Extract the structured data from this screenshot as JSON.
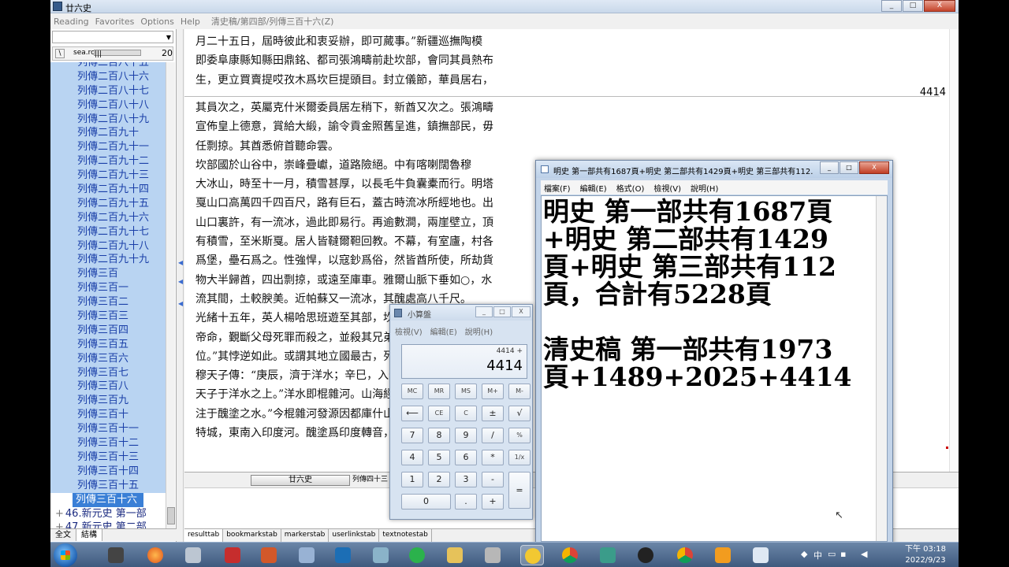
{
  "window": {
    "title": "廿六史",
    "controls": [
      "_",
      "□",
      "X"
    ]
  },
  "menubar": {
    "items": [
      "Reading",
      "Favorites",
      "Options",
      "Help"
    ],
    "path": "清史稿/第四部/列傳三百十六(Z)"
  },
  "left_pane": {
    "combo_value": "",
    "toolbar": {
      "icon": "\\",
      "label": "sea.rc",
      "slider": "|||",
      "number": "20"
    },
    "tree_items": [
      "列傳二百八十五",
      "列傳二百八十六",
      "列傳二百八十七",
      "列傳二百八十八",
      "列傳二百八十九",
      "列傳二百九十",
      "列傳二百九十一",
      "列傳二百九十二",
      "列傳二百九十三",
      "列傳二百九十四",
      "列傳二百九十五",
      "列傳二百九十六",
      "列傳二百九十七",
      "列傳二百九十八",
      "列傳二百九十九",
      "列傳三百",
      "列傳三百一",
      "列傳三百二",
      "列傳三百三",
      "列傳三百四",
      "列傳三百五",
      "列傳三百六",
      "列傳三百七",
      "列傳三百八",
      "列傳三百九",
      "列傳三百十",
      "列傳三百十一",
      "列傳三百十二",
      "列傳三百十三",
      "列傳三百十四",
      "列傳三百十五"
    ],
    "selected_item": "列傳三百十六",
    "books": [
      {
        "num": "46.",
        "label": "新元史 第一部"
      },
      {
        "num": "47.",
        "label": "新元史 第二部"
      }
    ],
    "tabs": [
      "全文",
      "結構"
    ]
  },
  "text_pane": {
    "page_number": "4414",
    "lines_top": [
      "月二十五日，屆時彼此和衷妥辦，即可蕆事。”新疆巡撫陶模",
      "即委阜康縣知縣田鼎銘、都司張鴻疇前赴坎部，會同其員熱布",
      "生，更立買賣提哎孜木爲坎巨提頭目。封立儀節，華員居右，"
    ],
    "lines_bottom": [
      "其員次之，英屬克什米爾委員居左稍下，新酋又次之。張鴻疇",
      "宣佈皇上德意，賞給大緞，諭令貢金照舊呈進，鎮撫部民，毋",
      "任剽掠。其酋悉俯首聽命雲。",
      "坎部國於山谷中，崇峰疊巘，道路險絕。中有喀喇闊魯穆",
      "大冰山，時至十一月，積雪甚厚，以長毛牛負囊橐而行。明塔",
      "戛山口高萬四千四百尺，路有巨石，蓋古時流冰所經地也。出",
      "山口裏許，有一流冰，過此即易行。再逾數澗，兩崖壁立，頂",
      "有積雪，至米斯戛。居人皆韃爾靼回教。不幕，有室廬，村各",
      "爲堡，壘石爲之。性強悍，以寇鈔爲俗，然皆酋所使，所劫貨",
      "物大半歸酋，四出剽掠，或遠至庫車。雅爾山脈下垂如○，水",
      "流其間，土較腴美。近帕蘇又一流冰，其醜處高八千尺。",
      "光緒十五年，英人楊哈思班遊至其部，坎",
      "帝命，覲斷父母死罪而殺之，並殺其兄弟",
      "位。”其悖逆如此。或謂其地立國最古，列",
      "穆天子傳：“庚辰，濟于洋水；辛巳，入于",
      "天子于洋水之上。”洋水即棍雜河。山海經",
      "注于醜塗之水。”今棍雜河發源因都庫什山",
      "特城，東南入印度河。醜塗爲印度轉音，"
    ],
    "bottom_tab": "廿六史",
    "bottom_tab2": "列傳四十三"
  },
  "result_tabs": [
    "resulttab",
    "bookmarkstab",
    "markerstab",
    "userlinkstab",
    "textnotestab"
  ],
  "notepad": {
    "title": "明史 第一部共有1687頁+明史 第二部共有1429頁+明史 第三部共有112...",
    "menu": [
      "檔案(F)",
      "編輯(E)",
      "格式(O)",
      "檢視(V)",
      "說明(H)"
    ],
    "text_lines": [
      "明史 第一部共有1687頁",
      "+明史 第二部共有1429",
      "頁+明史 第三部共有112",
      "頁，合計有5228頁",
      "",
      "清史稿 第一部共有1973",
      "頁+1489+2025+4414"
    ]
  },
  "calculator": {
    "title": "小算盤",
    "menu": [
      "檢視(V)",
      "編輯(E)",
      "說明(H)"
    ],
    "expression": "4414 +",
    "display": "4414",
    "keys": {
      "mc": "MC",
      "mr": "MR",
      "ms": "MS",
      "mplus": "M+",
      "mminus": "M-",
      "back": "⟵",
      "ce": "CE",
      "c": "C",
      "pm": "±",
      "sqrt": "√",
      "k7": "7",
      "k8": "8",
      "k9": "9",
      "div": "/",
      "pct": "%",
      "k4": "4",
      "k5": "5",
      "k6": "6",
      "mul": "*",
      "inv": "1/x",
      "k1": "1",
      "k2": "2",
      "k3": "3",
      "sub": "-",
      "eq": "=",
      "k0": "0",
      "dot": ".",
      "add": "+"
    }
  },
  "taskbar": {
    "tray_lang": "中",
    "time": "下午 03:18",
    "date": "2022/9/23"
  },
  "colors": {
    "tree_bg": "#b9d4f2",
    "tree_text": "#1a3fa8",
    "selected": "#3a7fd6",
    "taskbar": "#4f6b90"
  }
}
